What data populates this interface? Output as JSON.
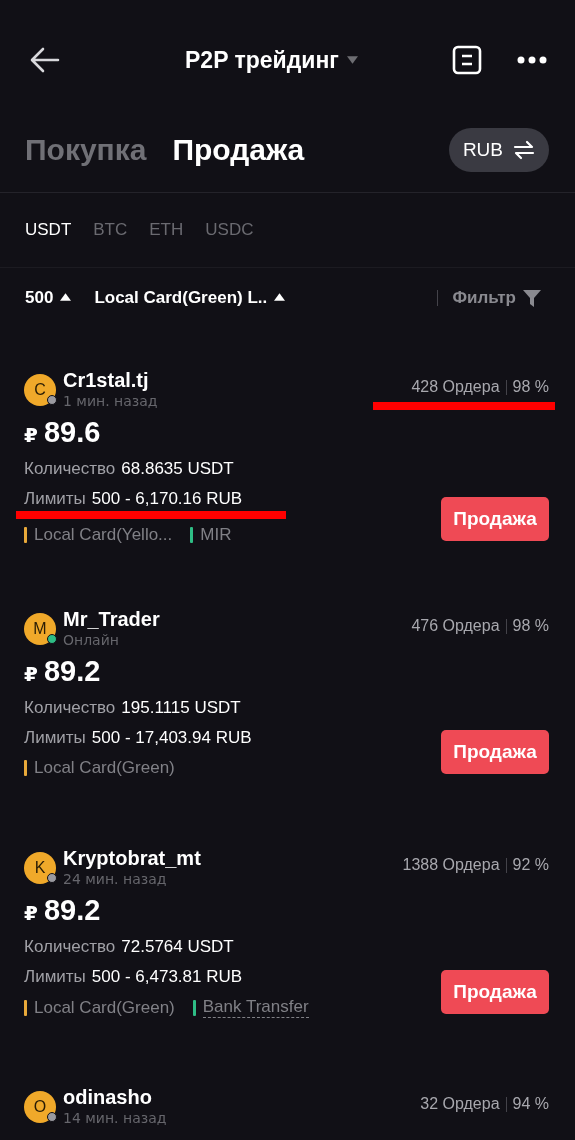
{
  "header": {
    "title": "P2P трейдинг"
  },
  "side_tabs": [
    {
      "label": "Покупка",
      "selected": false
    },
    {
      "label": "Продажа",
      "selected": true
    }
  ],
  "currency_button": {
    "label": "RUB"
  },
  "coin_tabs": [
    {
      "label": "USDT",
      "selected": true
    },
    {
      "label": "BTC",
      "selected": false
    },
    {
      "label": "ETH",
      "selected": false
    },
    {
      "label": "USDC",
      "selected": false
    }
  ],
  "filters": {
    "amount": "500",
    "payment": "Local Card(Green) L..",
    "filter": "Фильтр"
  },
  "offers": [
    {
      "initial": "C",
      "name": "Cr1stal.tj",
      "status": "1 мин. назад",
      "online": false,
      "orders": "428 Ордера",
      "rate": "98 %",
      "orders_underlined": true,
      "currency_sign": "₽",
      "price": "89.6",
      "qty_label": "Количество",
      "qty": "68.8635 USDT",
      "limit_label": "Лимиты",
      "limits": "500 - 6,170.16 RUB",
      "limits_underlined": true,
      "methods": [
        {
          "label": "Local Card(Yello...",
          "color": "#e8a93a",
          "dotted": false
        },
        {
          "label": "MIR",
          "color": "#2ebd85",
          "dotted": false
        }
      ],
      "button": "Продажа"
    },
    {
      "initial": "M",
      "name": "Mr_Trader",
      "status": "Онлайн",
      "online": true,
      "orders": "476 Ордера",
      "rate": "98 %",
      "orders_underlined": false,
      "currency_sign": "₽",
      "price": "89.2",
      "qty_label": "Количество",
      "qty": "195.1115 USDT",
      "limit_label": "Лимиты",
      "limits": "500 - 17,403.94 RUB",
      "limits_underlined": false,
      "methods": [
        {
          "label": "Local Card(Green)",
          "color": "#e8a93a",
          "dotted": false
        }
      ],
      "button": "Продажа"
    },
    {
      "initial": "K",
      "name": "Kryptobrat_mt",
      "status": "24 мин. назад",
      "online": false,
      "orders": "1388 Ордера",
      "rate": "92 %",
      "orders_underlined": false,
      "currency_sign": "₽",
      "price": "89.2",
      "qty_label": "Количество",
      "qty": "72.5764 USDT",
      "limit_label": "Лимиты",
      "limits": "500 - 6,473.81 RUB",
      "limits_underlined": false,
      "methods": [
        {
          "label": "Local Card(Green)",
          "color": "#e8a93a",
          "dotted": false
        },
        {
          "label": "Bank Transfer",
          "color": "#2ebd85",
          "dotted": true
        }
      ],
      "button": "Продажа"
    },
    {
      "initial": "O",
      "name": "odinasho",
      "status": "14 мин. назад",
      "online": false,
      "orders": "32 Ордера",
      "rate": "94 %",
      "orders_underlined": false
    }
  ]
}
